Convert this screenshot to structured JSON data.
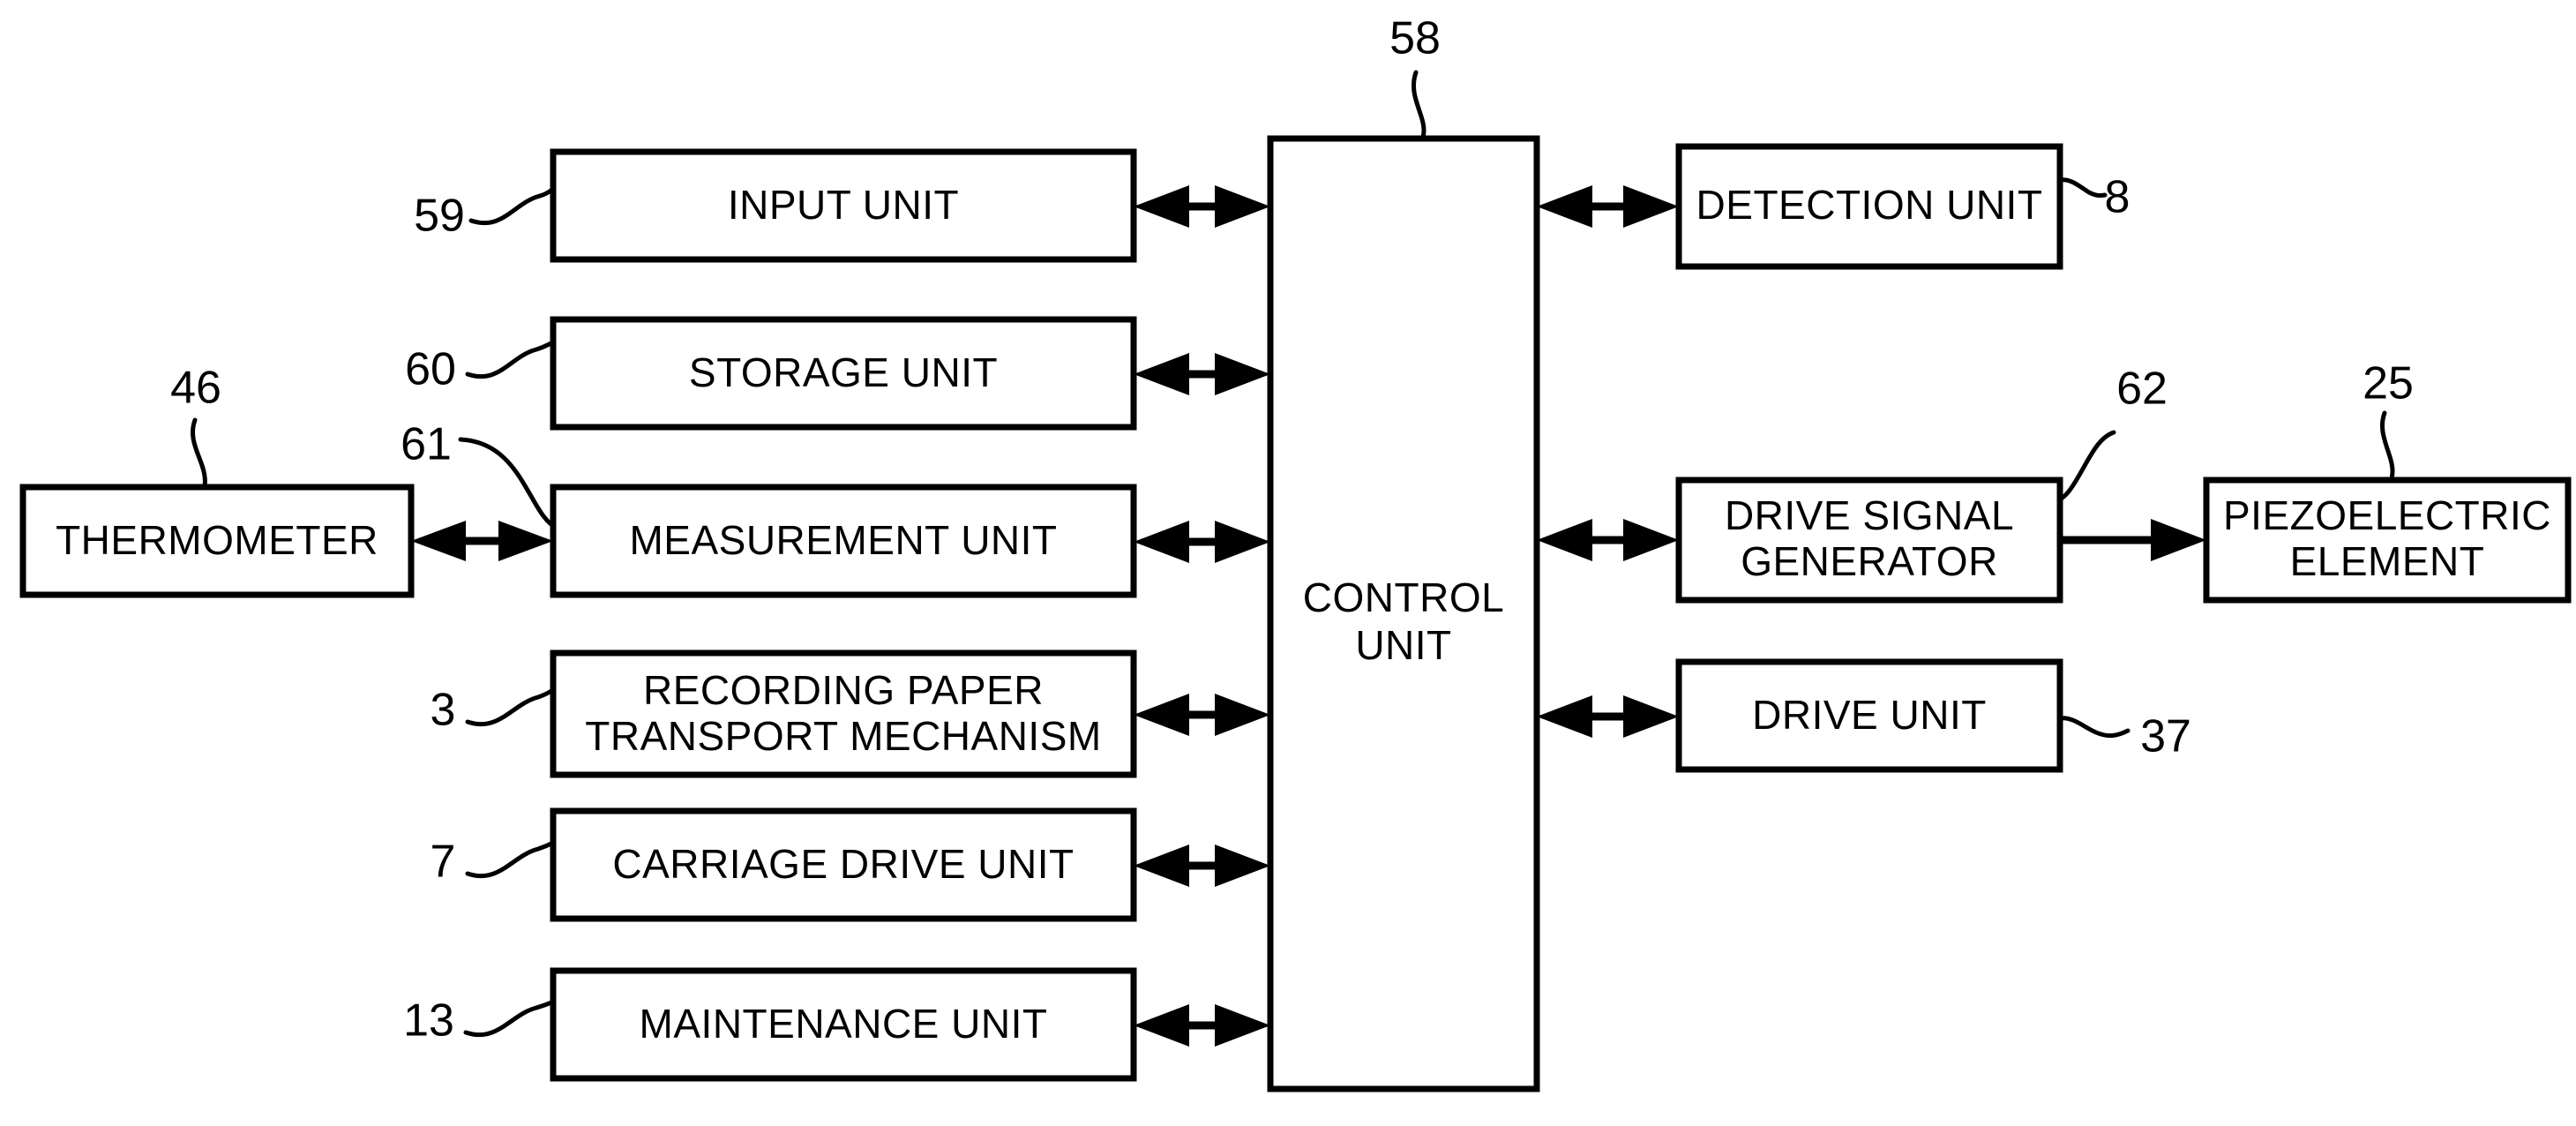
{
  "figure": {
    "type": "patent-block-diagram",
    "background_color": "#ffffff",
    "line_color": "#000000"
  },
  "blocks": {
    "input_unit": {
      "label": "INPUT UNIT",
      "ref": "59"
    },
    "storage_unit": {
      "label": "STORAGE UNIT",
      "ref": "60"
    },
    "measurement_unit": {
      "label": "MEASUREMENT UNIT",
      "ref": "61"
    },
    "recording_paper_transport_mechanism": {
      "label_line1": "RECORDING PAPER",
      "label_line2": "TRANSPORT MECHANISM",
      "ref": "3"
    },
    "carriage_drive_unit": {
      "label": "CARRIAGE DRIVE UNIT",
      "ref": "7"
    },
    "maintenance_unit": {
      "label": "MAINTENANCE UNIT",
      "ref": "13"
    },
    "thermometer": {
      "label": "THERMOMETER",
      "ref": "46"
    },
    "control_unit": {
      "label_line1": "CONTROL",
      "label_line2": "UNIT",
      "ref": "58"
    },
    "detection_unit": {
      "label": "DETECTION UNIT",
      "ref": "8"
    },
    "drive_signal_generator": {
      "label_line1": "DRIVE SIGNAL",
      "label_line2": "GENERATOR",
      "ref": "62"
    },
    "piezoelectric_element": {
      "label_line1": "PIEZOELECTRIC",
      "label_line2": "ELEMENT",
      "ref": "25"
    },
    "drive_unit": {
      "label": "DRIVE UNIT",
      "ref": "37"
    }
  },
  "connections": [
    {
      "from": "input_unit",
      "to": "control_unit",
      "kind": "bidirectional"
    },
    {
      "from": "storage_unit",
      "to": "control_unit",
      "kind": "bidirectional"
    },
    {
      "from": "measurement_unit",
      "to": "control_unit",
      "kind": "bidirectional"
    },
    {
      "from": "recording_paper_transport_mechanism",
      "to": "control_unit",
      "kind": "bidirectional"
    },
    {
      "from": "carriage_drive_unit",
      "to": "control_unit",
      "kind": "bidirectional"
    },
    {
      "from": "maintenance_unit",
      "to": "control_unit",
      "kind": "bidirectional"
    },
    {
      "from": "thermometer",
      "to": "measurement_unit",
      "kind": "bidirectional"
    },
    {
      "from": "control_unit",
      "to": "detection_unit",
      "kind": "bidirectional"
    },
    {
      "from": "control_unit",
      "to": "drive_signal_generator",
      "kind": "bidirectional"
    },
    {
      "from": "control_unit",
      "to": "drive_unit",
      "kind": "bidirectional"
    },
    {
      "from": "drive_signal_generator",
      "to": "piezoelectric_element",
      "kind": "unidirectional"
    }
  ]
}
